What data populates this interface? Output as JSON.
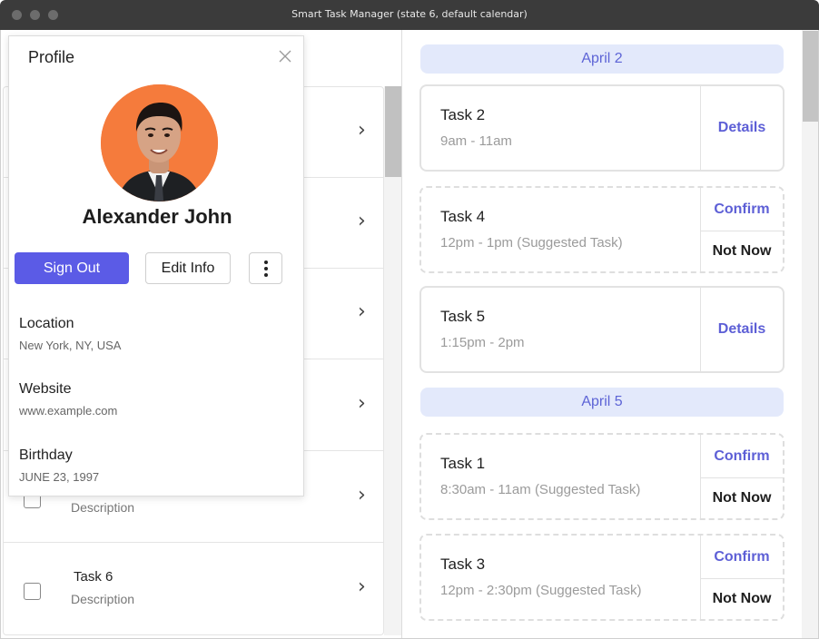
{
  "window": {
    "title": "Smart Task Manager (state 6, default calendar)"
  },
  "task_list": {
    "rows": [
      {
        "name": "",
        "description": ""
      },
      {
        "name": "",
        "description": ""
      },
      {
        "name": "",
        "description": ""
      },
      {
        "name": "",
        "description": ""
      },
      {
        "name": "",
        "description": "Description"
      },
      {
        "name": "Task 6",
        "description": "Description"
      }
    ]
  },
  "calendar": {
    "groups": [
      {
        "date": "April 2",
        "tasks": [
          {
            "name": "Task 2",
            "time": "9am - 11am",
            "suggested": false,
            "action": "Details"
          },
          {
            "name": "Task 4",
            "time": "12pm - 1pm (Suggested Task)",
            "suggested": true,
            "confirm": "Confirm",
            "not_now": "Not Now"
          },
          {
            "name": "Task 5",
            "time": "1:15pm - 2pm",
            "suggested": false,
            "action": "Details"
          }
        ]
      },
      {
        "date": "April 5",
        "tasks": [
          {
            "name": "Task 1",
            "time": "8:30am - 11am (Suggested Task)",
            "suggested": true,
            "confirm": "Confirm",
            "not_now": "Not Now"
          },
          {
            "name": "Task 3",
            "time": "12pm - 2:30pm (Suggested Task)",
            "suggested": true,
            "confirm": "Confirm",
            "not_now": "Not Now"
          }
        ]
      }
    ]
  },
  "profile": {
    "title": "Profile",
    "name": "Alexander John",
    "sign_out": "Sign Out",
    "edit_info": "Edit Info",
    "fields": [
      {
        "label": "Location",
        "value": "New York, NY, USA"
      },
      {
        "label": "Website",
        "value": "www.example.com"
      },
      {
        "label": "Birthday",
        "value": "JUNE 23, 1997"
      }
    ]
  },
  "colors": {
    "accent": "#5b5be6",
    "link": "#5d5fd6",
    "date_header_bg": "#e3e9fb",
    "avatar_bg": "#f57b3c"
  },
  "icons": [
    "close-icon",
    "more-vertical-icon",
    "chevron-right-icon",
    "checkbox-icon"
  ]
}
